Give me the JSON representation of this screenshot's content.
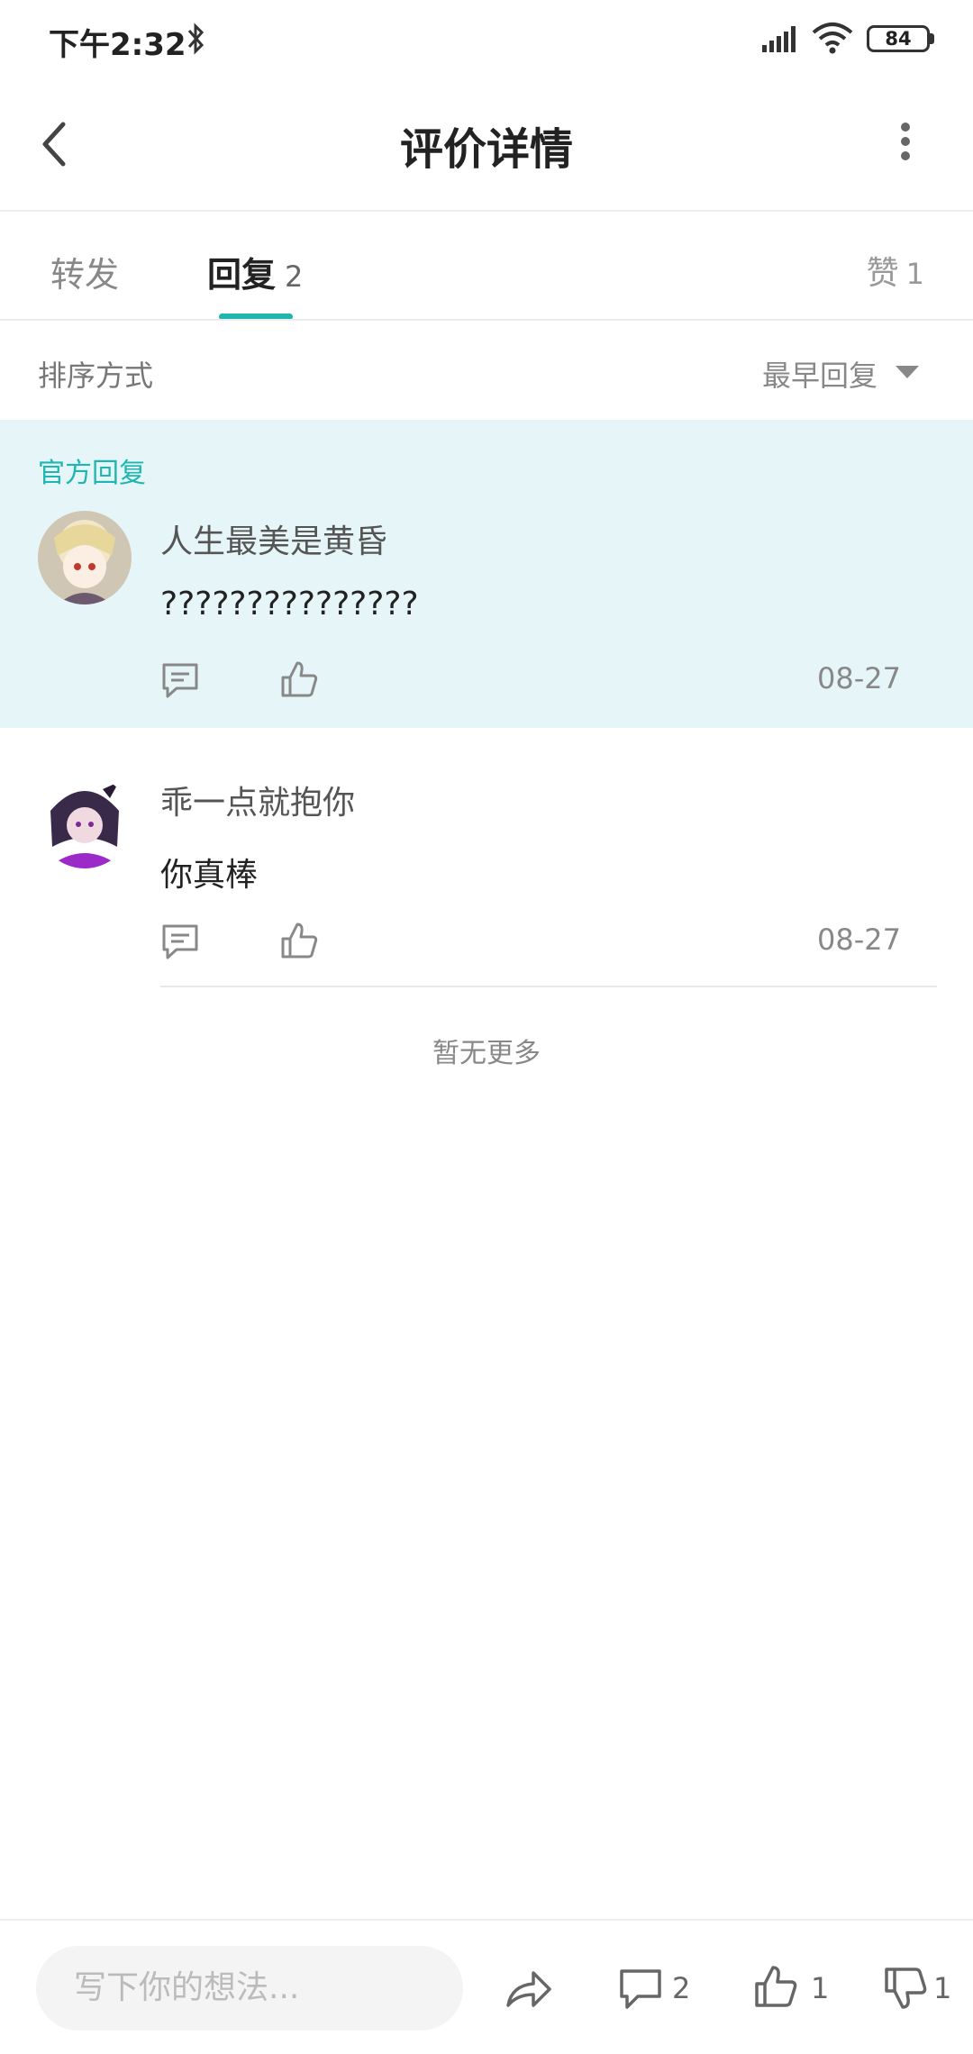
{
  "status_bar": {
    "time": "下午2:32",
    "battery": "84"
  },
  "header": {
    "title": "评价详情"
  },
  "tabs": {
    "forward": {
      "label": "转发"
    },
    "reply": {
      "label": "回复",
      "count": "2"
    },
    "like": {
      "label": "赞",
      "count": "1"
    }
  },
  "sort": {
    "label": "排序方式",
    "selected": "最早回复"
  },
  "official": {
    "section_label": "官方回复",
    "username": "人生最美是黄昏",
    "content": "???????????????",
    "date": "08-27"
  },
  "replies": [
    {
      "username": "乖一点就抱你",
      "content": "你真棒",
      "date": "08-27"
    }
  ],
  "no_more": "暂无更多",
  "bottom_bar": {
    "input_placeholder": "写下你的想法...",
    "comment_count": "2",
    "like_count": "1",
    "dislike_count": "1"
  },
  "colors": {
    "accent": "#1fb5b0",
    "official_bg": "#e6f6f8"
  }
}
